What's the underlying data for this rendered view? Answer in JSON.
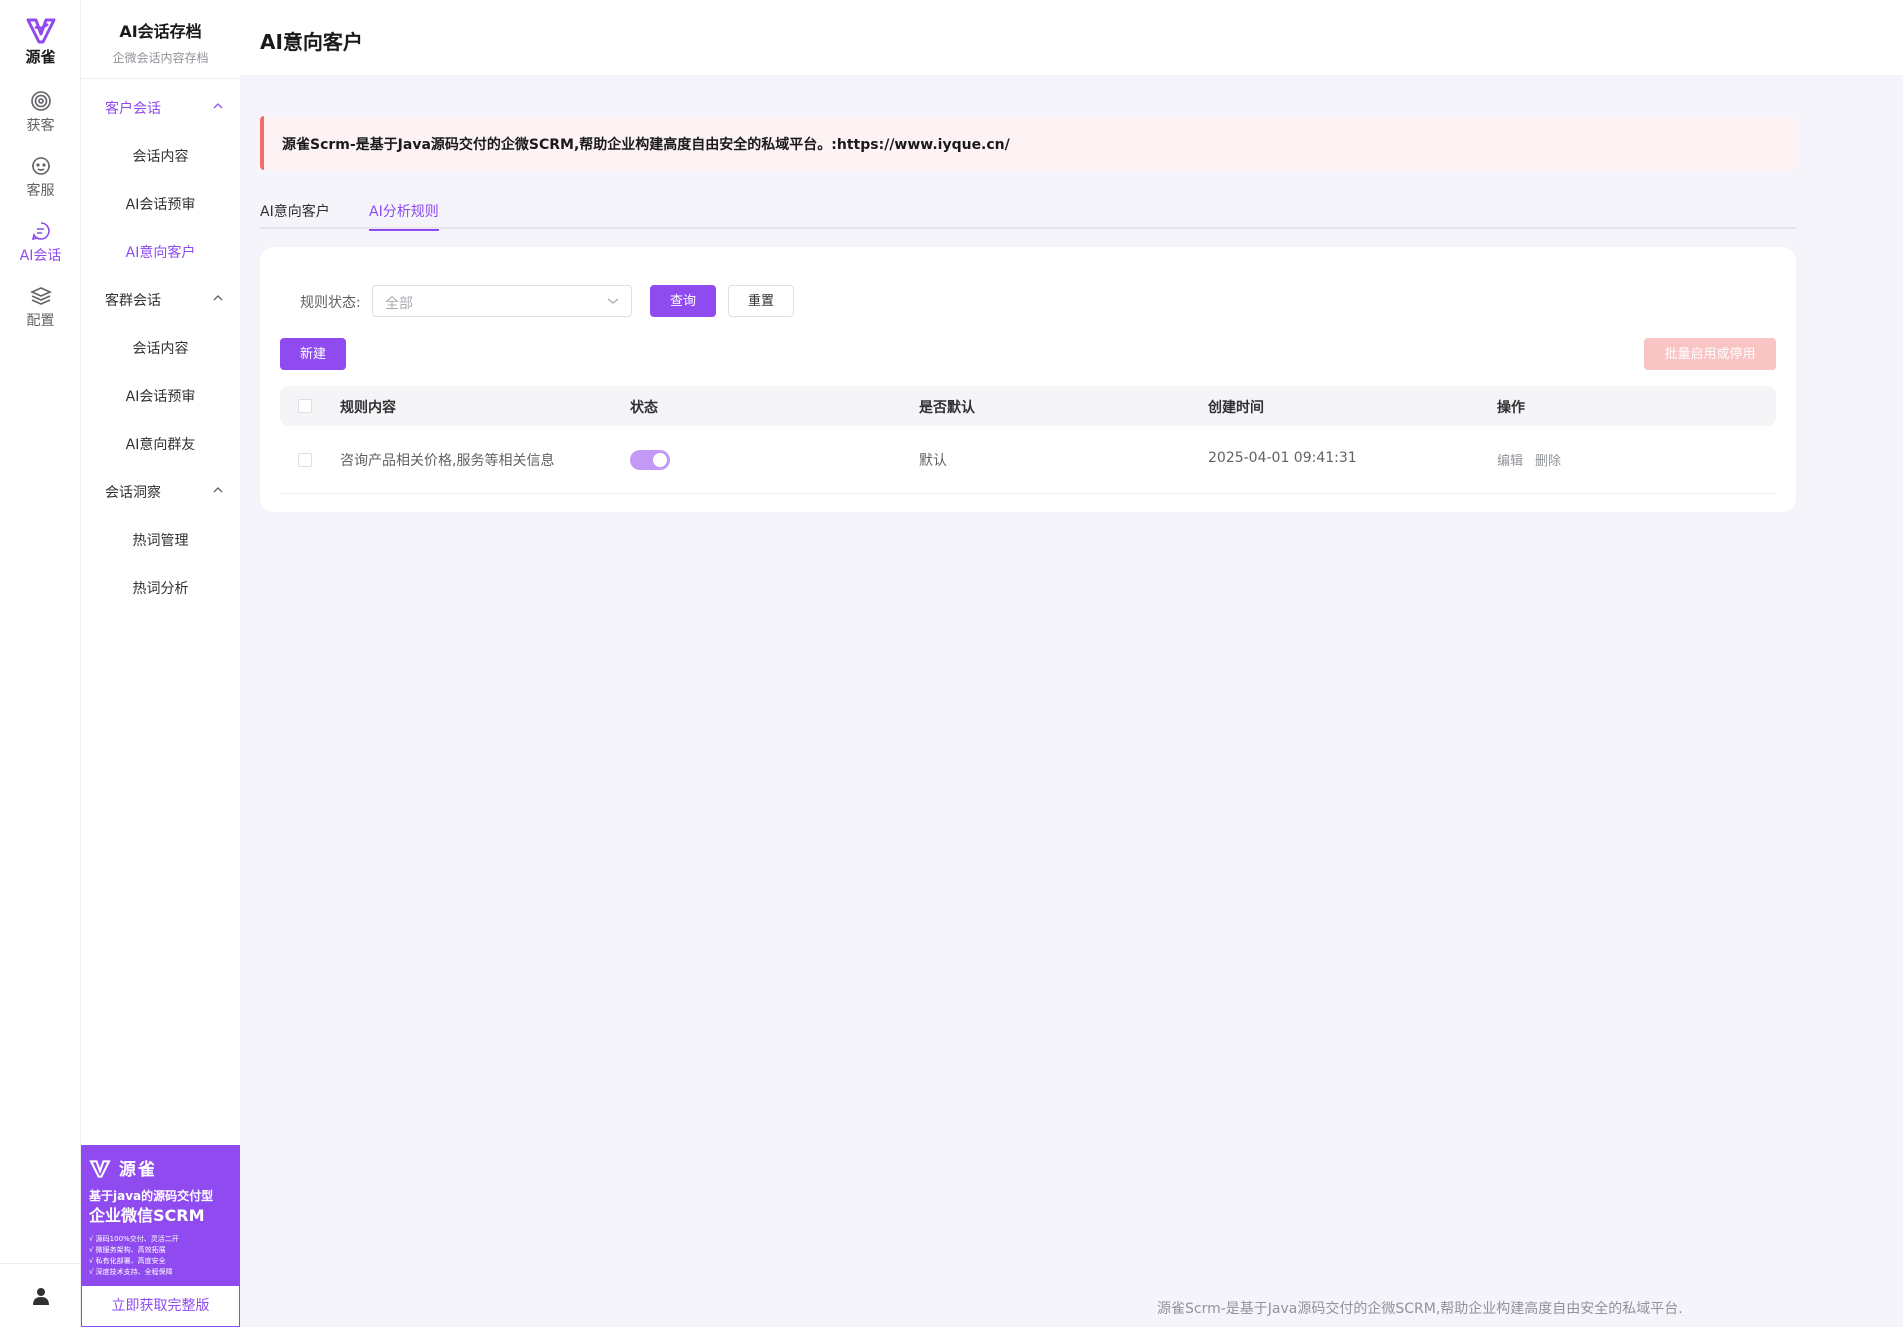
{
  "colors": {
    "accent": "#8f4bf0",
    "danger_light": "#f8c4c4",
    "notice_border": "#f56c6c"
  },
  "rail": {
    "logo_text": "源雀",
    "items": [
      {
        "label": "获客",
        "icon": "target-icon"
      },
      {
        "label": "客服",
        "icon": "service-face-icon"
      },
      {
        "label": "AI会话",
        "icon": "chat-icon"
      },
      {
        "label": "配置",
        "icon": "layers-icon"
      }
    ]
  },
  "submenu": {
    "title": "AI会话存档",
    "subtitle": "企微会话内容存档",
    "groups": [
      {
        "label": "客户会话",
        "items": [
          "会话内容",
          "AI会话预审",
          "AI意向客户"
        ]
      },
      {
        "label": "客群会话",
        "items": [
          "会话内容",
          "AI会话预审",
          "AI意向群友"
        ]
      },
      {
        "label": "会话洞察",
        "items": [
          "热词管理",
          "热词分析"
        ]
      }
    ]
  },
  "promo": {
    "brand": "源雀",
    "line1": "基于java的源码交付型",
    "line2": "企业微信SCRM",
    "bullets": [
      "√ 源码100%交付、灵活二开",
      "√ 微服务架构、高效拓展",
      "√ 私有化部署、高度安全",
      "√ 深度技术支持、全程保障"
    ],
    "button": "立即获取完整版"
  },
  "header": {
    "title": "AI意向客户"
  },
  "notice": {
    "text": "源雀Scrm-是基于Java源码交付的企微SCRM,帮助企业构建高度自由安全的私域平台。:https://www.iyque.cn/"
  },
  "tabs": [
    "AI意向客户",
    "AI分析规则"
  ],
  "filter": {
    "label": "规则状态:",
    "placeholder": "全部",
    "query": "查询",
    "reset": "重置"
  },
  "toolbar": {
    "new": "新建",
    "batch": "批量启用或停用"
  },
  "table": {
    "columns": [
      "规则内容",
      "状态",
      "是否默认",
      "创建时间",
      "操作"
    ],
    "rows": [
      {
        "content": "咨询产品相关价格,服务等相关信息",
        "enabled": true,
        "default": "默认",
        "created": "2025-04-01 09:41:31",
        "actions": [
          "编辑",
          "删除"
        ]
      }
    ]
  },
  "footer": {
    "text": "源雀Scrm-是基于Java源码交付的企微SCRM,帮助企业构建高度自由安全的私域平台."
  }
}
